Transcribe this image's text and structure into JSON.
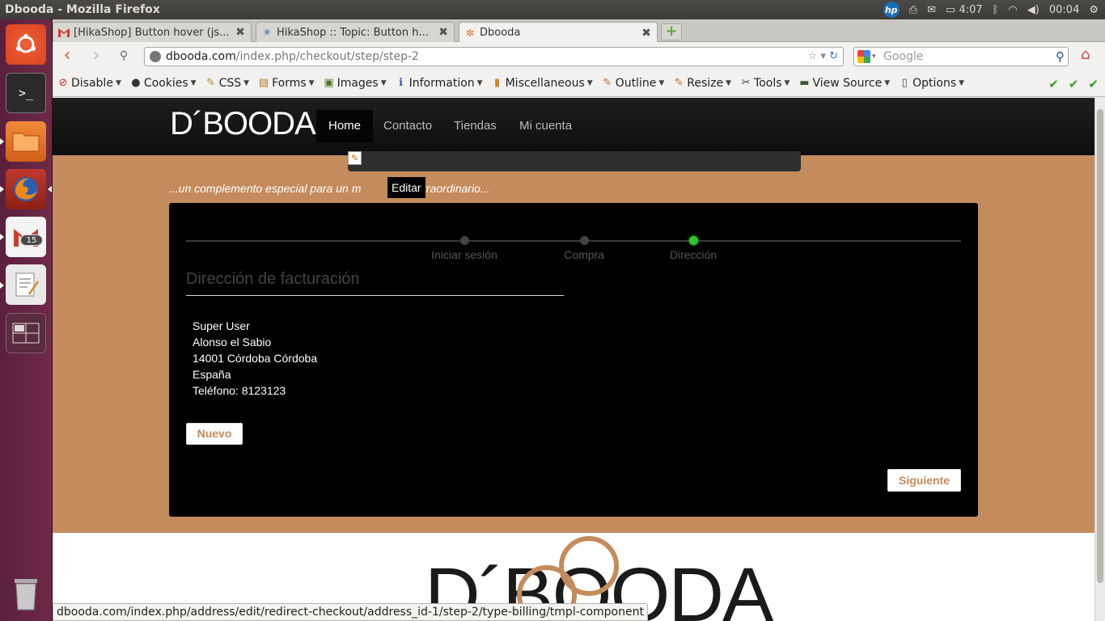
{
  "top_panel": {
    "window_title": "Dbooda - Mozilla Firefox",
    "battery": "4:07",
    "clock": "00:04",
    "hp_label": "hp"
  },
  "launcher": {
    "items": [
      "ubuntu-logo",
      "terminal",
      "files",
      "firefox",
      "gmail",
      "text-editor",
      "workspace-switcher",
      "trash"
    ],
    "gmail_badge": "15"
  },
  "browser": {
    "tabs": [
      {
        "label": "[HikaShop] Button hover (js...",
        "icon": "gmail-icon",
        "close": "✖"
      },
      {
        "label": "HikaShop :: Topic: Button h...",
        "icon": "hikashop-icon",
        "close": "✖"
      },
      {
        "label": "Dbooda",
        "icon": "joomla-icon",
        "close": "✖"
      }
    ],
    "newtab": "+",
    "url_domain": "dbooda.com",
    "url_path": "/index.php/checkout/step/step-2",
    "search_placeholder": "Google",
    "devbar": [
      {
        "label": "Disable",
        "icon": "⊘",
        "color": "#cc2a1a"
      },
      {
        "label": "Cookies",
        "icon": "●",
        "color": "#333333"
      },
      {
        "label": "CSS",
        "icon": "✎",
        "color": "#b08a2a"
      },
      {
        "label": "Forms",
        "icon": "▤",
        "color": "#b0782a"
      },
      {
        "label": "Images",
        "icon": "▣",
        "color": "#4a7a2a"
      },
      {
        "label": "Information",
        "icon": "ℹ",
        "color": "#2a5ab0"
      },
      {
        "label": "Miscellaneous",
        "icon": "▮",
        "color": "#c88a2a"
      },
      {
        "label": "Outline",
        "icon": "✎",
        "color": "#c86a2a"
      },
      {
        "label": "Resize",
        "icon": "✎",
        "color": "#c86a2a"
      },
      {
        "label": "Tools",
        "icon": "✂",
        "color": "#444444"
      },
      {
        "label": "View Source",
        "icon": "▬",
        "color": "#3a5a3a"
      },
      {
        "label": "Options",
        "icon": "▯",
        "color": "#444444"
      }
    ],
    "status_url": "dbooda.com/index.php/address/edit/redirect-checkout/address_id-1/step-2/type-billing/tmpl-component"
  },
  "site": {
    "logo": "D´BOODA",
    "menu": [
      "Home",
      "Contacto",
      "Tiendas",
      "Mi cuenta"
    ],
    "tagline_start": "...un complemento especial para un m",
    "tagline_end": " extraordinario...",
    "tooltip": "Editar",
    "steps": [
      "Iniciar sesión",
      "Compra",
      "Dirección"
    ],
    "billing_title": "Dirección de facturación",
    "address": [
      "Super User",
      "Alonso el Sabio",
      "14001 Córdoba Córdoba",
      "España",
      "Teléfono: 8123123"
    ],
    "btn_new": "Nuevo",
    "btn_next": "Siguiente",
    "footer_logo": "D´BOODA",
    "accent": "#c48b5c",
    "step_active_color": "#2ec52e"
  }
}
